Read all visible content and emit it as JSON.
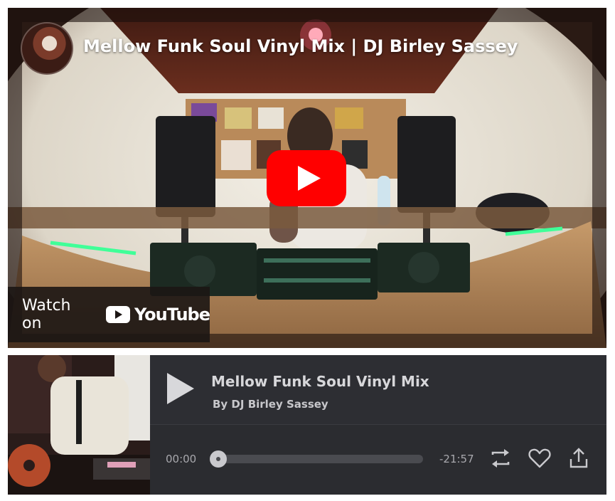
{
  "youtube": {
    "video_title": "Mellow Funk Soul Vinyl Mix | DJ Birley Sassey",
    "watch_on_label": "Watch on",
    "logo_text": "YouTube",
    "colors": {
      "play_red": "#ff0000",
      "overlay": "#1c1614"
    }
  },
  "audio_player": {
    "track_title": "Mellow Funk Soul Vinyl Mix",
    "artist_line": "By DJ Birley Sassey",
    "time_elapsed": "00:00",
    "time_remaining": "-21:57",
    "progress": 0,
    "icons": [
      "play-icon",
      "repeat-icon",
      "heart-icon",
      "share-icon"
    ]
  }
}
